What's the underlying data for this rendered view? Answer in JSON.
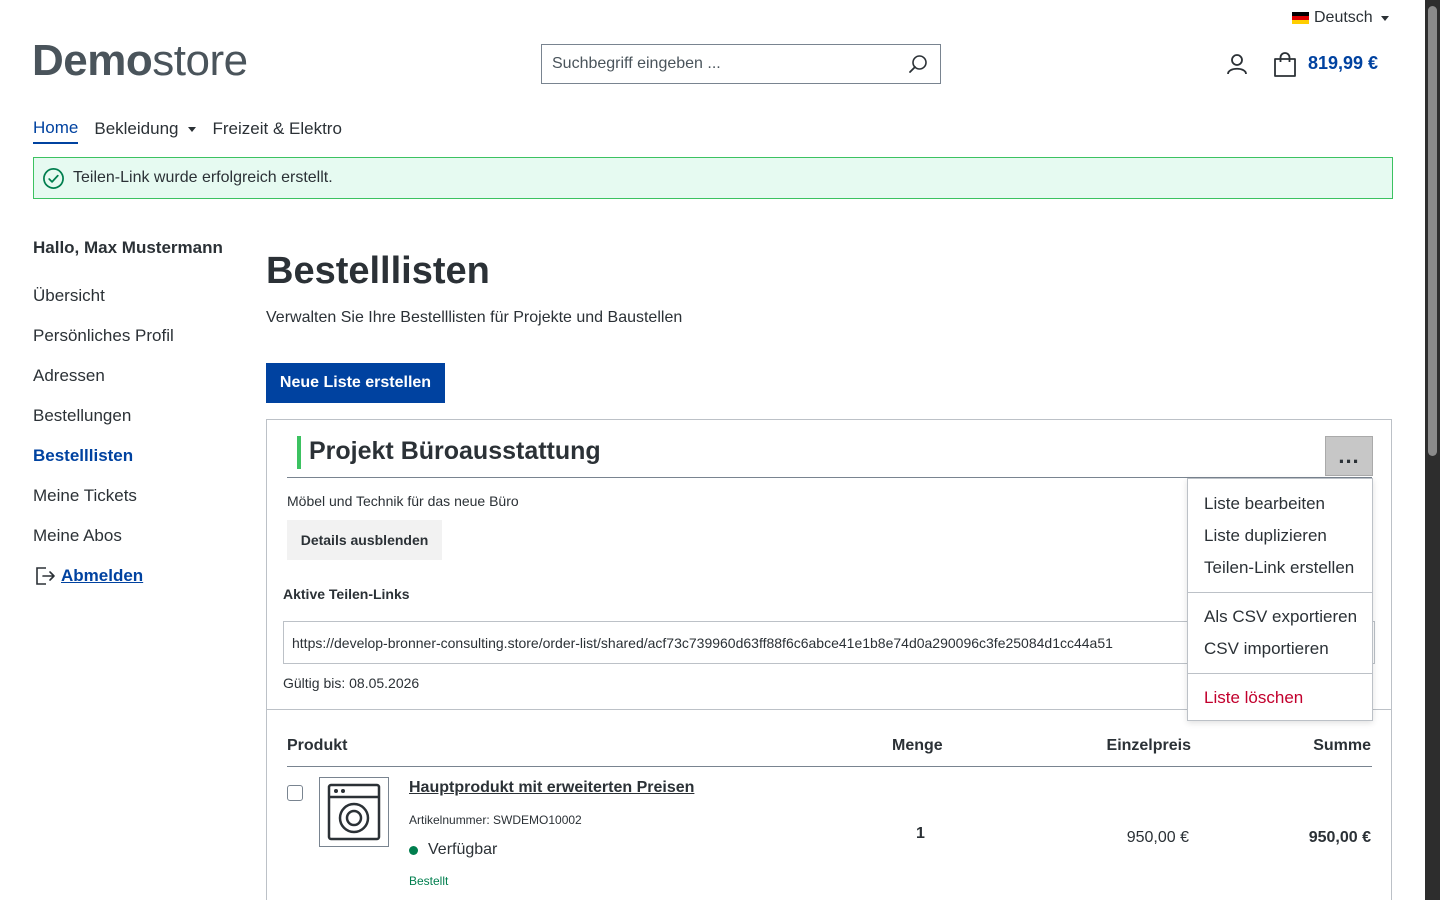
{
  "header": {
    "language": "Deutsch",
    "logo_bold": "Demo",
    "logo_light": "store",
    "search_placeholder": "Suchbegriff eingeben ...",
    "cart_total": "819,99 €"
  },
  "nav": {
    "items": [
      {
        "label": "Home",
        "active": true
      },
      {
        "label": "Bekleidung",
        "dropdown": true
      },
      {
        "label": "Freizeit & Elektro"
      }
    ]
  },
  "alert": {
    "message": "Teilen-Link wurde erfolgreich erstellt.",
    "color": "#3cc261"
  },
  "sidebar": {
    "greeting": "Hallo, Max Mustermann",
    "items": [
      {
        "label": "Übersicht"
      },
      {
        "label": "Persönliches Profil"
      },
      {
        "label": "Adressen"
      },
      {
        "label": "Bestellungen"
      },
      {
        "label": "Bestelllisten",
        "active": true
      },
      {
        "label": "Meine Tickets"
      },
      {
        "label": "Meine Abos"
      }
    ],
    "logout": "Abmelden"
  },
  "main": {
    "title": "Bestelllisten",
    "subtitle": "Verwalten Sie Ihre Bestelllisten für Projekte und Baustellen",
    "create_button": "Neue Liste erstellen",
    "list": {
      "title": "Projekt Büroausstattung",
      "description": "Möbel und Technik für das neue Büro",
      "toggle_details": "Details ausblenden",
      "share_links_title": "Aktive Teilen-Links",
      "share_link": "https://develop-bronner-consulting.store/order-list/shared/acf73c739960d63ff88f6c6abce41e1b8e74d0a290096c3fe25084d1cc44a51",
      "valid_until": "Gültig bis: 08.05.2026",
      "menu_button": "...",
      "menu": {
        "edit": "Liste bearbeiten",
        "duplicate": "Liste duplizieren",
        "share": "Teilen-Link erstellen",
        "export_csv": "Als CSV exportieren",
        "import_csv": "CSV importieren",
        "delete": "Liste löschen"
      },
      "table": {
        "headers": {
          "product": "Produkt",
          "quantity": "Menge",
          "unit_price": "Einzelpreis",
          "sum": "Summe"
        },
        "rows": [
          {
            "name": "Hauptprodukt mit erweiterten Preisen",
            "sku": "Artikelnummer: SWDEMO10002",
            "availability": "Verfügbar",
            "status": "Bestellt",
            "quantity": "1",
            "unit_price": "950,00 €",
            "sum": "950,00 €",
            "icon": "washing-machine-icon"
          }
        ]
      }
    }
  },
  "colors": {
    "primary": "#0042a0",
    "success": "#007e4e",
    "danger": "#c2002d"
  }
}
